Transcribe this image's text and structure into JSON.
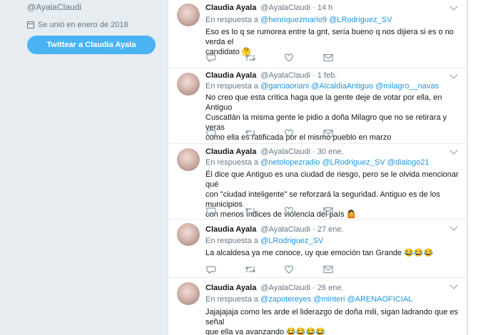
{
  "profile": {
    "handle": "@AyalaClaudi",
    "joined": "Se unió en enero de 2018",
    "tweet_to_button": "Twittear a Claudia Ayala"
  },
  "tweets": [
    {
      "name": "Claudia Ayala",
      "handle": "@AyalaClaudi",
      "time": "· 14 h",
      "reply_prefix": "En respuesta a ",
      "reply_to": "@henriquezmario9 @LRodriguez_SV",
      "lines": [
        "Eso es lo q se rumorea entre la gnt, sería bueno q nos dijiera si es o no verda el",
        "candidato 🤔"
      ]
    },
    {
      "name": "Claudia Ayala",
      "handle": "@AyalaClaudi",
      "time": "· 1 feb.",
      "reply_prefix": "En respuesta a ",
      "reply_to": "@garciaoriani @AlcaldiaAntiguo @milagro__navas",
      "lines": [
        "No creo que esta crítica haga que la gente deje de votar por ella, en Antiguo",
        "Cuscatlán la misma gente le pidio a doña Milagro que no se retirara y veras",
        "como ella es ratificada por el mismo pueblo en marzo"
      ]
    },
    {
      "name": "Claudia Ayala",
      "handle": "@AyalaClaudi",
      "time": "· 30 ene.",
      "reply_prefix": "En respuesta a ",
      "reply_to": "@netolopezradio @LRodriguez_SV @dialogo21",
      "lines": [
        "Él dice que Antiguo es una ciudad de riesgo, pero se le olvida mencionar qué",
        "con \"ciudad inteligente\" se reforzará la seguridad. Antiguo es de los municipios",
        "con menos índices de violencia del país 🤷"
      ]
    },
    {
      "name": "Claudia Ayala",
      "handle": "@AyalaClaudi",
      "time": "· 27 ene.",
      "reply_prefix": "En respuesta a ",
      "reply_to": "@LRodriguez_SV",
      "lines": [
        "La alcaldesa ya me conoce, uy que emoción tan Grande 😂😂😂"
      ]
    },
    {
      "name": "Claudia Ayala",
      "handle": "@AyalaClaudi",
      "time": "· 26 ene.",
      "reply_prefix": "En respuesta a ",
      "reply_to": "@zapotereyes @minteri @ARENAOFICIAL",
      "lines": [
        "Jajajajaja como les arde el liderazgo de doña mili, sigan ladrando que es señal",
        "que ella va avanzando 😂😂😂😂"
      ]
    }
  ],
  "icons": [
    "reply-icon",
    "retweet-icon",
    "like-icon",
    "message-icon",
    "calendar-icon",
    "caret-down-icon"
  ],
  "colors": {
    "link": "#1b95e0",
    "muted": "#657786",
    "button": "#4ab3f4",
    "background": "#e6ecf0"
  }
}
